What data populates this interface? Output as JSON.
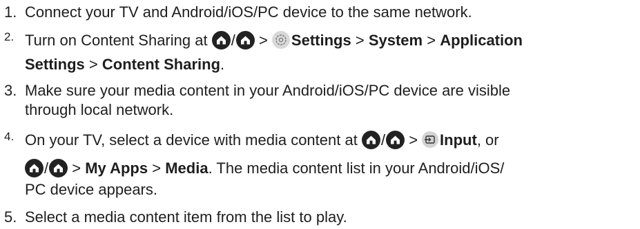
{
  "steps": [
    {
      "number": "1.",
      "line1": "Connect your TV and Android/iOS/PC device to the same network."
    },
    {
      "number": "2.",
      "text_a": "Turn on Content Sharing at ",
      "sep_gt": ">",
      "settings_label": "Settings",
      "system_label": "System",
      "app_settings_label": "Application",
      "app_settings_label2": "Settings",
      "content_sharing_label": "Content Sharing",
      "end": "."
    },
    {
      "number": "3.",
      "line1": "Make sure your media content in your Android/iOS/PC device are visible",
      "line2": "through local network."
    },
    {
      "number": "4.",
      "text_a": "On your TV, select a device with media content at ",
      "input_label": "Input",
      "text_b": ", or",
      "my_apps_label": "My Apps",
      "media_label": "Media",
      "text_c": ". The media content list in your Android/iOS/",
      "line3": "PC device appears."
    },
    {
      "number": "5.",
      "line1": "Select a media content item from the list to play."
    }
  ],
  "icons": {
    "home": "home-icon",
    "settings": "gear-icon",
    "input": "input-icon"
  }
}
